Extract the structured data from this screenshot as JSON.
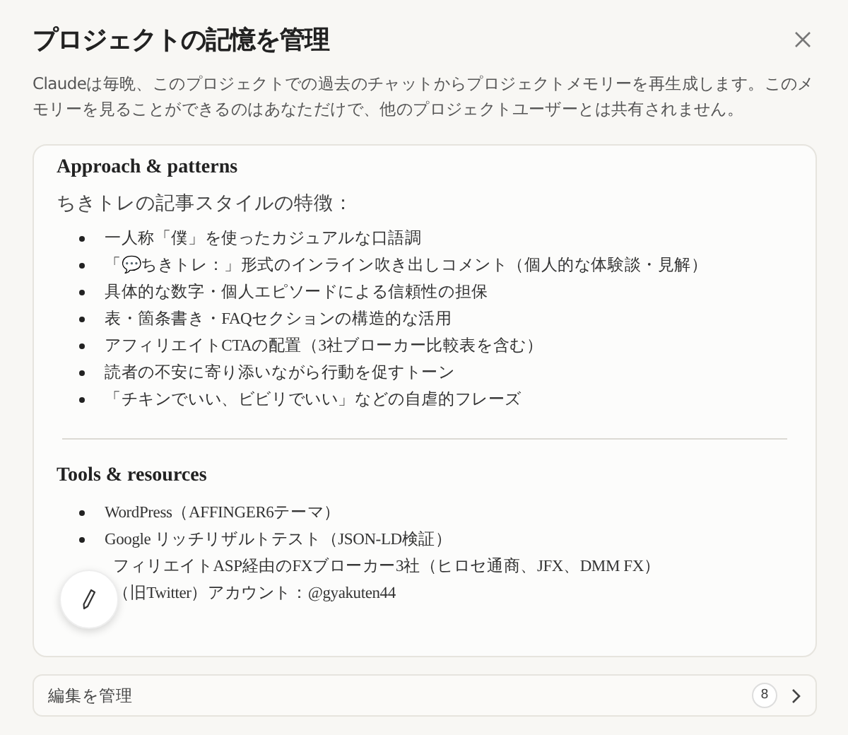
{
  "dialog": {
    "title": "プロジェクトの記憶を管理",
    "description": "Claudeは毎晩、このプロジェクトでの過去のチャットからプロジェクトメモリーを再生成します。このメモリーを見ることができるのはあなただけで、他のプロジェクトユーザーとは共有されません。"
  },
  "sections": [
    {
      "heading": "Approach & patterns",
      "intro": "ちきトレの記事スタイルの特徴：",
      "items": [
        {
          "text": "一人称「僕」を使ったカジュアルな口語調",
          "kind": "bullet"
        },
        {
          "text": "「💬ちきトレ：」形式のインライン吹き出しコメント（個人的な体験談・見解）",
          "kind": "bullet"
        },
        {
          "text": "具体的な数字・個人エピソードによる信頼性の担保",
          "kind": "bullet"
        },
        {
          "text": "表・箇条書き・FAQセクションの構造的な活用",
          "kind": "bullet"
        },
        {
          "text": "アフィリエイトCTAの配置（3社ブローカー比較表を含む）",
          "kind": "bullet"
        },
        {
          "text": "読者の不安に寄り添いながら行動を促すトーン",
          "kind": "bullet"
        },
        {
          "text": "「チキンでいい、ビビリでいい」などの自虐的フレーズ",
          "kind": "bullet"
        }
      ]
    },
    {
      "heading": "Tools & resources",
      "items": [
        {
          "text": "WordPress（AFFINGER6テーマ）",
          "kind": "bullet"
        },
        {
          "text": "Google リッチリザルトテスト（JSON-LD検証）",
          "kind": "bullet"
        },
        {
          "text": "フィリエイトASP経由のFXブローカー3社（ヒロセ通商、JFX、DMM FX）",
          "kind": "covered"
        },
        {
          "text": "（旧Twitter）アカウント：@gyakuten44",
          "kind": "covered"
        }
      ]
    }
  ],
  "footer": {
    "label": "編集を管理",
    "count": "8"
  }
}
